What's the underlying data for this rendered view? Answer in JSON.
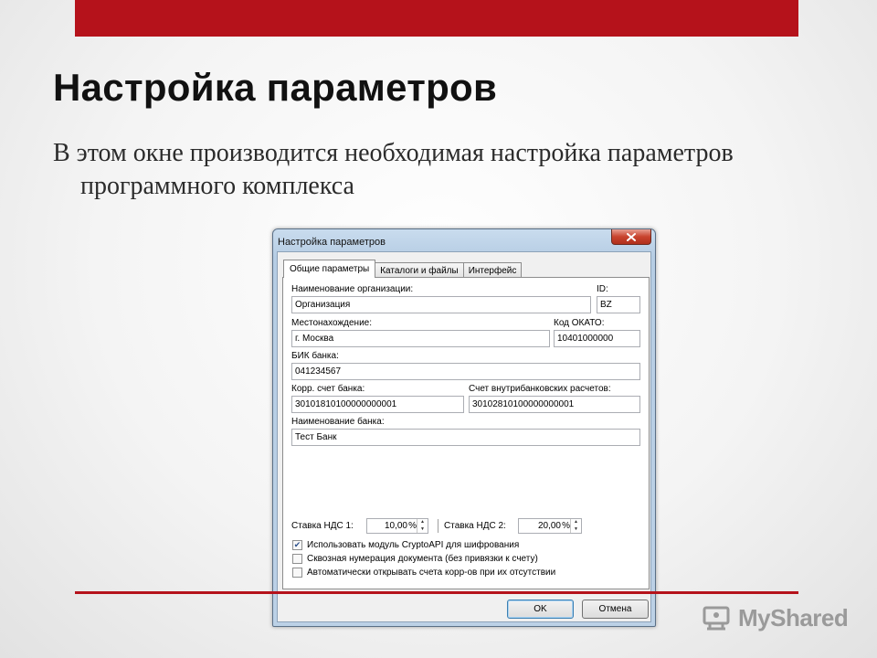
{
  "slide": {
    "title": "Настройка параметров",
    "body": "В этом окне производится необходимая настройка параметров программного комплекса",
    "watermark": "MyShared",
    "accent_color": "#b5121b"
  },
  "window": {
    "title": "Настройка параметров",
    "close_icon": "close-icon",
    "tabs": [
      {
        "label": "Общие параметры",
        "active": true
      },
      {
        "label": "Каталоги и файлы",
        "active": false
      },
      {
        "label": "Интерфейс",
        "active": false
      }
    ],
    "fields": {
      "org_name": {
        "label": "Наименование организации:",
        "value": "Организация"
      },
      "id": {
        "label": "ID:",
        "value": "BZ"
      },
      "location": {
        "label": "Местонахождение:",
        "value": "г. Москва"
      },
      "okato": {
        "label": "Код ОКАТО:",
        "value": "10401000000"
      },
      "bik": {
        "label": "БИК банка:",
        "value": "041234567"
      },
      "corr_account": {
        "label": "Корр. счет банка:",
        "value": "30101810100000000001"
      },
      "internal_account": {
        "label": "Счет внутрибанковских расчетов:",
        "value": "30102810100000000001"
      },
      "bank_name": {
        "label": "Наименование банка:",
        "value": "Тест Банк"
      }
    },
    "vat": {
      "rate1": {
        "label": "Ставка НДС 1:",
        "value": "10,00",
        "unit": "%"
      },
      "rate2": {
        "label": "Ставка НДС 2:",
        "value": "20,00",
        "unit": "%"
      }
    },
    "checkboxes": [
      {
        "label": "Использовать модуль CryptoAPI для шифрования",
        "checked": true
      },
      {
        "label": "Сквозная нумерация документа (без привязки к счету)",
        "checked": false
      },
      {
        "label": "Автоматически открывать счета корр-ов при их отсутствии",
        "checked": false
      }
    ],
    "buttons": {
      "ok": "OK",
      "cancel": "Отмена"
    }
  }
}
